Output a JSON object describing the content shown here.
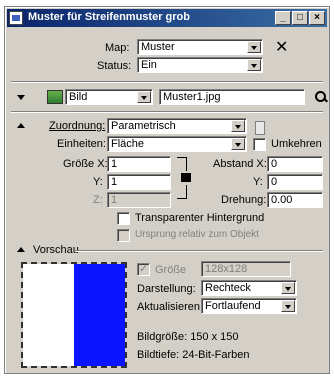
{
  "window": {
    "title": "Muster für Streifenmuster grob",
    "minimize": "_",
    "maximize": "□",
    "close": "×"
  },
  "map": {
    "label": "Map:",
    "value": "Muster"
  },
  "status": {
    "label": "Status:",
    "value": "Ein"
  },
  "source": {
    "type_value": "Bild",
    "file_value": "Muster1.jpg"
  },
  "assignment": {
    "label": "Zuordnung:",
    "value": "Parametrisch",
    "units_label": "Einheiten:",
    "units_value": "Fläche",
    "swap_label": "Umkehren"
  },
  "size": {
    "x_label": "Größe X:",
    "x_value": "1",
    "y_label": "Y:",
    "y_value": "1",
    "z_label": "Z:",
    "z_value": "1"
  },
  "offset": {
    "x_label": "Abstand X:",
    "x_value": "0",
    "y_label": "Y:",
    "y_value": "0",
    "rotation_label": "Drehung:",
    "rotation_value": "0.00"
  },
  "options": {
    "transparent_bg": "Transparenter Hintergrund",
    "origin_relative": "Ursprung relativ zum Objekt"
  },
  "preview": {
    "section_label": "Vorschau",
    "size_label": "Größe",
    "size_value": "128x128",
    "display_label": "Darstellung:",
    "display_value": "Rechteck",
    "refresh_label": "Aktualisieren:",
    "refresh_value": "Fortlaufend",
    "image_size": "Bildgröße: 150 x 150",
    "image_depth": "Bildtiefe: 24-Bit-Farben",
    "colors": {
      "left": "#ffffff",
      "right": "#0a14ff"
    }
  }
}
